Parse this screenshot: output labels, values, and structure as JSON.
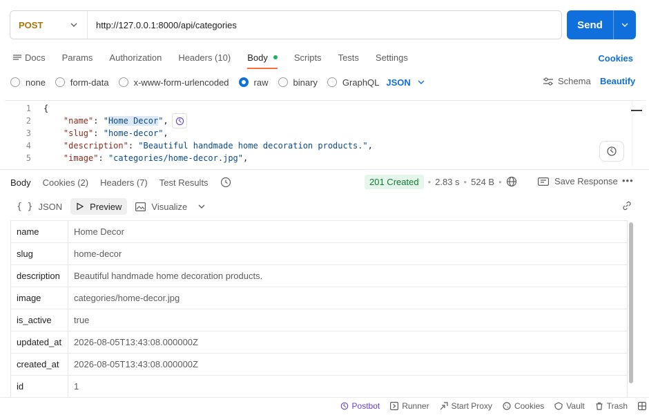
{
  "request": {
    "method": "POST",
    "url": "http://127.0.0.1:8000/api/categories",
    "send_label": "Send"
  },
  "request_tabs": [
    {
      "label": "Docs"
    },
    {
      "label": "Params"
    },
    {
      "label": "Authorization"
    },
    {
      "label": "Headers (10)"
    },
    {
      "label": "Body"
    },
    {
      "label": "Scripts"
    },
    {
      "label": "Tests"
    },
    {
      "label": "Settings"
    }
  ],
  "cookies_link": "Cookies",
  "body_types": {
    "options": [
      "none",
      "form-data",
      "x-www-form-urlencoded",
      "raw",
      "binary",
      "GraphQL"
    ],
    "selected": "raw",
    "format": "JSON",
    "schema_label": "Schema",
    "beautify_label": "Beautify"
  },
  "editor": {
    "line_numbers": [
      "1",
      "2",
      "3",
      "4",
      "5"
    ],
    "line1": "{",
    "l2_key": "\"name\"",
    "l2_val_q1": "\"",
    "l2_val_hl": "Home Decor",
    "l2_val_q2": "\"",
    "l3_key": "\"slug\"",
    "l3_val": "\"home-decor\"",
    "l4_key": "\"description\"",
    "l4_val": "\"Beautiful handmade home decoration products.\"",
    "l5_key": "\"image\"",
    "l5_val": "\"categories/home-decor.jpg\""
  },
  "response_tabs": [
    {
      "label": "Body"
    },
    {
      "label": "Cookies (2)"
    },
    {
      "label": "Headers (7)"
    },
    {
      "label": "Test Results"
    }
  ],
  "response_meta": {
    "status": "201 Created",
    "time": "2.83 s",
    "size": "524 B",
    "save_label": "Save Response",
    "status_color": "#127a35"
  },
  "view_modes": {
    "json": "JSON",
    "preview": "Preview",
    "visualize": "Visualize"
  },
  "preview_rows": [
    {
      "key": "name",
      "value": "Home Decor"
    },
    {
      "key": "slug",
      "value": "home-decor"
    },
    {
      "key": "description",
      "value": "Beautiful handmade home decoration products."
    },
    {
      "key": "image",
      "value": "categories/home-decor.jpg"
    },
    {
      "key": "is_active",
      "value": "true"
    },
    {
      "key": "updated_at",
      "value": "2026-08-05T13:43:08.000000Z"
    },
    {
      "key": "created_at",
      "value": "2026-08-05T13:43:08.000000Z"
    },
    {
      "key": "id",
      "value": "1"
    }
  ],
  "statusbar": {
    "postbot": "Postbot",
    "runner": "Runner",
    "start_proxy": "Start Proxy",
    "cookies": "Cookies",
    "vault": "Vault",
    "trash": "Trash"
  },
  "colors": {
    "accent": "#0f6fdc",
    "active_tab": "#ff6c37",
    "method": "#a6770b"
  }
}
